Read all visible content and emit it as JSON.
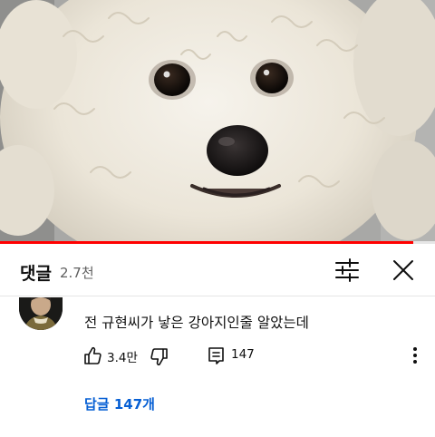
{
  "video": {
    "progress_fraction": 0.95,
    "colors": {
      "progress": "#ff0000",
      "track": "#e6e6e6"
    }
  },
  "comments_panel": {
    "title": "댓글",
    "count": "2.7천",
    "filter_icon": "sliders-icon",
    "close_icon": "close-icon"
  },
  "comment": {
    "avatar_icon": "user-avatar",
    "text": "전 규현씨가 낳은 강아지인줄 알았는데",
    "likes": "3.4만",
    "like_icon": "thumbs-up-icon",
    "dislike_icon": "thumbs-down-icon",
    "reply_icon": "reply-icon",
    "reply_count": "147",
    "more_icon": "more-vert-icon",
    "replies_link": "답글 147개",
    "link_color": "#065fd4"
  }
}
